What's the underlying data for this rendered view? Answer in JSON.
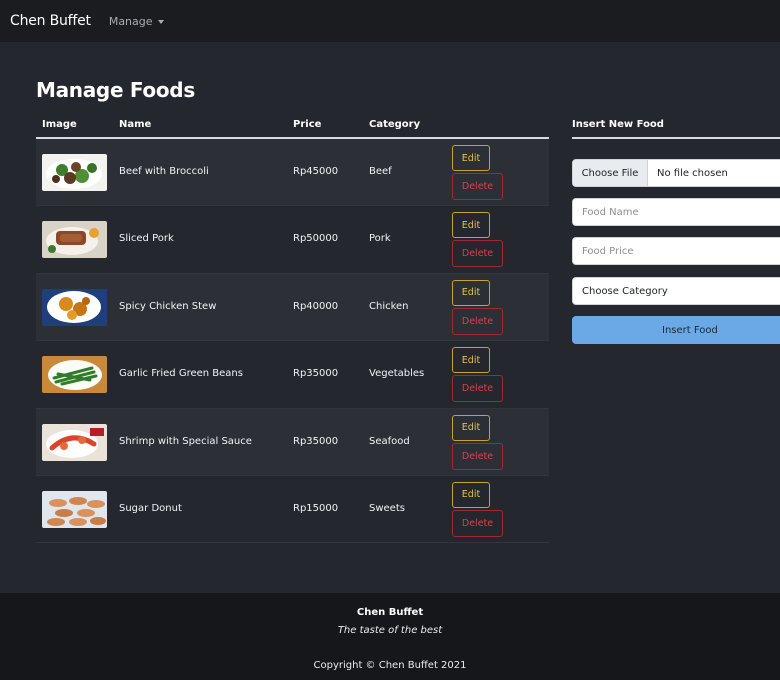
{
  "navbar": {
    "brand": "Chen Buffet",
    "manage": "Manage"
  },
  "page_title": "Manage Foods",
  "table": {
    "headers": {
      "image": "Image",
      "name": "Name",
      "price": "Price",
      "category": "Category"
    },
    "rows": [
      {
        "name": "Beef with Broccoli",
        "price": "Rp45000",
        "category": "Beef",
        "edit": "Edit",
        "delete": "Delete"
      },
      {
        "name": "Sliced Pork",
        "price": "Rp50000",
        "category": "Pork",
        "edit": "Edit",
        "delete": "Delete"
      },
      {
        "name": "Spicy Chicken Stew",
        "price": "Rp40000",
        "category": "Chicken",
        "edit": "Edit",
        "delete": "Delete"
      },
      {
        "name": "Garlic Fried Green Beans",
        "price": "Rp35000",
        "category": "Vegetables",
        "edit": "Edit",
        "delete": "Delete"
      },
      {
        "name": "Shrimp with Special Sauce",
        "price": "Rp35000",
        "category": "Seafood",
        "edit": "Edit",
        "delete": "Delete"
      },
      {
        "name": "Sugar Donut",
        "price": "Rp15000",
        "category": "Sweets",
        "edit": "Edit",
        "delete": "Delete"
      }
    ]
  },
  "insert_form": {
    "title": "Insert New Food",
    "file_button": "Choose File",
    "file_status": "No file chosen",
    "name_placeholder": "Food Name",
    "price_placeholder": "Food Price",
    "category_select": "Choose Category",
    "submit": "Insert Food"
  },
  "footer": {
    "brand": "Chen Buffet",
    "tagline": "The taste of the best",
    "copyright": "Copyright © Chen Buffet 2021"
  },
  "colors": {
    "background": "#24272d",
    "navbar": "#1a1c20",
    "footer": "#15171a",
    "edit": "#e5c04a",
    "delete": "#d9414d",
    "primary": "#6aa8e6"
  }
}
